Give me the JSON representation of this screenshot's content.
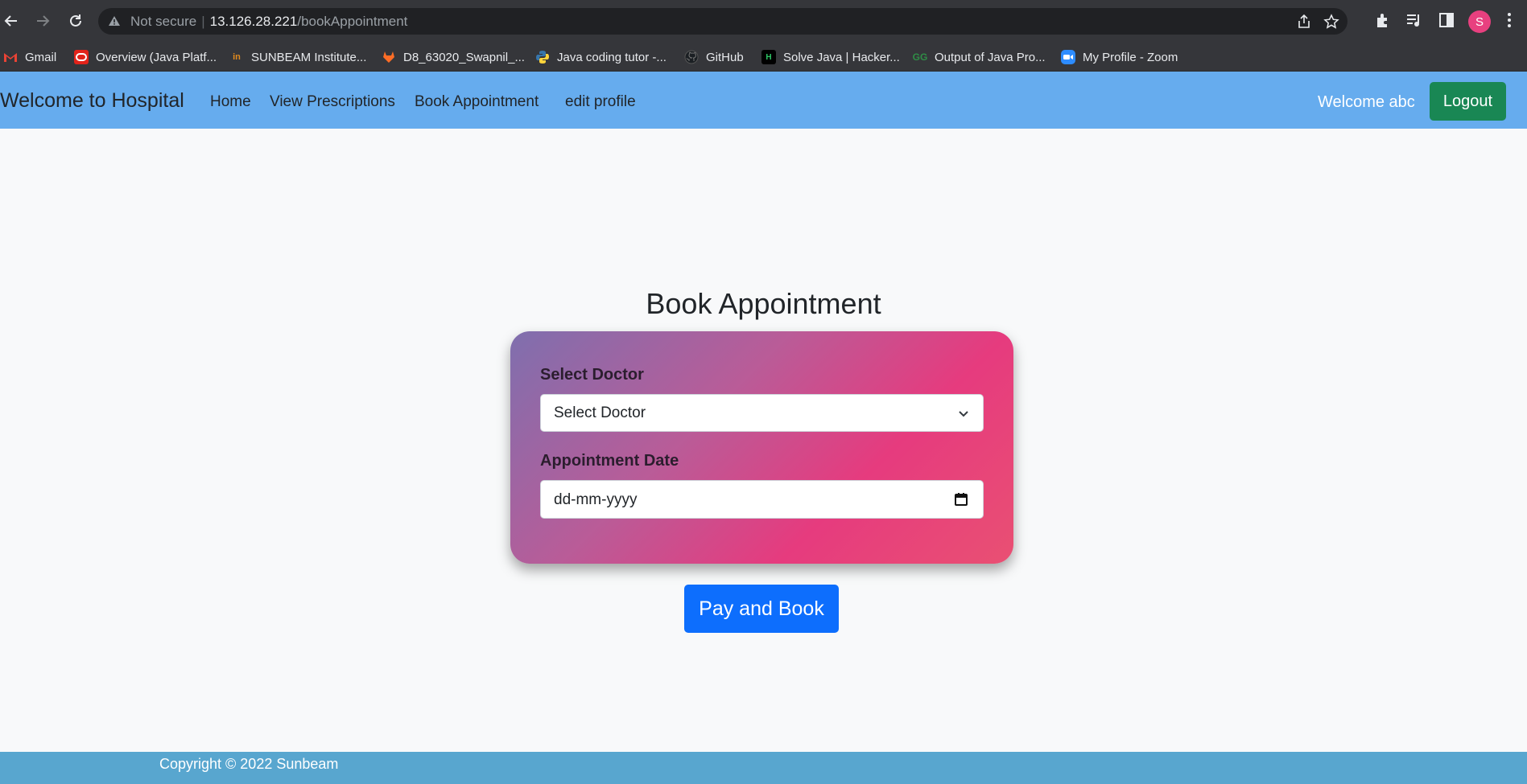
{
  "browser": {
    "security_label": "Not secure",
    "url_host": "13.126.28.221",
    "url_path": "/bookAppointment",
    "profile_initial": "S"
  },
  "bookmarks": [
    {
      "label": "Gmail",
      "icon": "gmail-icon"
    },
    {
      "label": "Overview (Java Platf...",
      "icon": "oracle-icon"
    },
    {
      "label": "SUNBEAM Institute...",
      "icon": "sunbeam-icon"
    },
    {
      "label": "D8_63020_Swapnil_...",
      "icon": "gitlab-icon"
    },
    {
      "label": "Java coding tutor -...",
      "icon": "python-icon"
    },
    {
      "label": "GitHub",
      "icon": "github-icon"
    },
    {
      "label": "Solve Java | Hacker...",
      "icon": "hackerrank-icon"
    },
    {
      "label": "Output of Java Pro...",
      "icon": "geeksforgeeks-icon"
    },
    {
      "label": "My Profile - Zoom",
      "icon": "zoom-icon"
    }
  ],
  "navbar": {
    "brand": "Welcome to Hospital",
    "links": [
      "Home",
      "View Prescriptions",
      "Book Appointment",
      "edit profile"
    ],
    "welcome": "Welcome abc",
    "logout": "Logout"
  },
  "main": {
    "title": "Book Appointment",
    "doctor_label": "Select Doctor",
    "doctor_selected": "Select Doctor",
    "date_label": "Appointment Date",
    "date_placeholder": "dd-mm-yyyy",
    "submit": "Pay and Book"
  },
  "footer": {
    "text": "Copyright © 2022 Sunbeam"
  },
  "colors": {
    "navbar": "#66acee",
    "logout": "#198754",
    "primary": "#0d6efd",
    "footer": "#58a6cf"
  }
}
